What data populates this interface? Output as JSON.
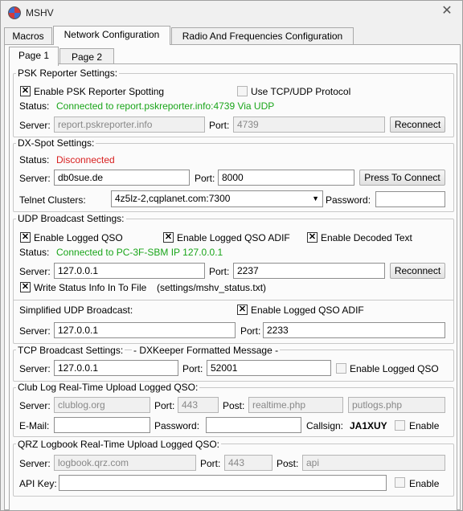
{
  "window": {
    "title": "MSHV"
  },
  "tabs": [
    "Macros",
    "Network Configuration",
    "Radio And Frequencies Configuration"
  ],
  "subtabs": [
    "Page 1",
    "Page 2"
  ],
  "psk": {
    "title": "PSK Reporter Settings:",
    "enable_label": "Enable PSK Reporter Spotting",
    "enable_checked": true,
    "tcp_label": "Use TCP/UDP Protocol",
    "tcp_checked": false,
    "status_label": "Status:",
    "status_value": "Connected to report.pskreporter.info:4739 Via UDP",
    "server_label": "Server:",
    "server_value": "report.pskreporter.info",
    "port_label": "Port:",
    "port_value": "4739",
    "reconnect_label": "Reconnect"
  },
  "dx": {
    "title": "DX-Spot Settings:",
    "status_label": "Status:",
    "status_value": "Disconnected",
    "server_label": "Server:",
    "server_value": "db0sue.de",
    "port_label": "Port:",
    "port_value": "8000",
    "connect_label": "Press To Connect",
    "telnet_label": "Telnet Clusters:",
    "telnet_value": "4z5lz-2,cqplanet.com:7300",
    "password_label": "Password:",
    "password_value": ""
  },
  "udp": {
    "title": "UDP Broadcast Settings:",
    "logged_qso_label": "Enable Logged QSO",
    "logged_qso_checked": true,
    "logged_adif_label": "Enable Logged QSO ADIF",
    "logged_adif_checked": true,
    "decoded_label": "Enable Decoded Text",
    "decoded_checked": true,
    "status_label": "Status:",
    "status_value": "Connected to PC-3F-SBM IP 127.0.0.1",
    "server_label": "Server:",
    "server_value": "127.0.0.1",
    "port_label": "Port:",
    "port_value": "2237",
    "reconnect_label": "Reconnect",
    "write_status_label": "Write Status Info In To File",
    "write_status_checked": true,
    "write_status_path": "(settings/mshv_status.txt)",
    "simplified_label": "Simplified UDP Broadcast:",
    "simplified_adif_label": "Enable Logged QSO ADIF",
    "simplified_adif_checked": true,
    "s_server_label": "Server:",
    "s_server_value": "127.0.0.1",
    "s_port_label": "Port:",
    "s_port_value": "2233"
  },
  "tcp": {
    "title": "TCP Broadcast Settings:",
    "subtitle": "- DXKeeper Formatted Message -",
    "server_label": "Server:",
    "server_value": "127.0.0.1",
    "port_label": "Port:",
    "port_value": "52001",
    "enable_label": "Enable Logged QSO",
    "enable_checked": false
  },
  "clublog": {
    "title": "Club Log Real-Time Upload Logged QSO:",
    "server_label": "Server:",
    "server_value": "clublog.org",
    "port_label": "Port:",
    "port_value": "443",
    "post_label": "Post:",
    "post_value": "realtime.php",
    "post2_value": "putlogs.php",
    "email_label": "E-Mail:",
    "email_value": "",
    "password_label": "Password:",
    "password_value": "",
    "callsign_label": "Callsign:",
    "callsign_value": "JA1XUY",
    "enable_label": "Enable",
    "enable_checked": false
  },
  "qrz": {
    "title": "QRZ Logbook Real-Time Upload Logged QSO:",
    "server_label": "Server:",
    "server_value": "logbook.qrz.com",
    "port_label": "Port:",
    "port_value": "443",
    "post_label": "Post:",
    "post_value": "api",
    "apikey_label": "API Key:",
    "apikey_value": "",
    "enable_label": "Enable",
    "enable_checked": false
  }
}
